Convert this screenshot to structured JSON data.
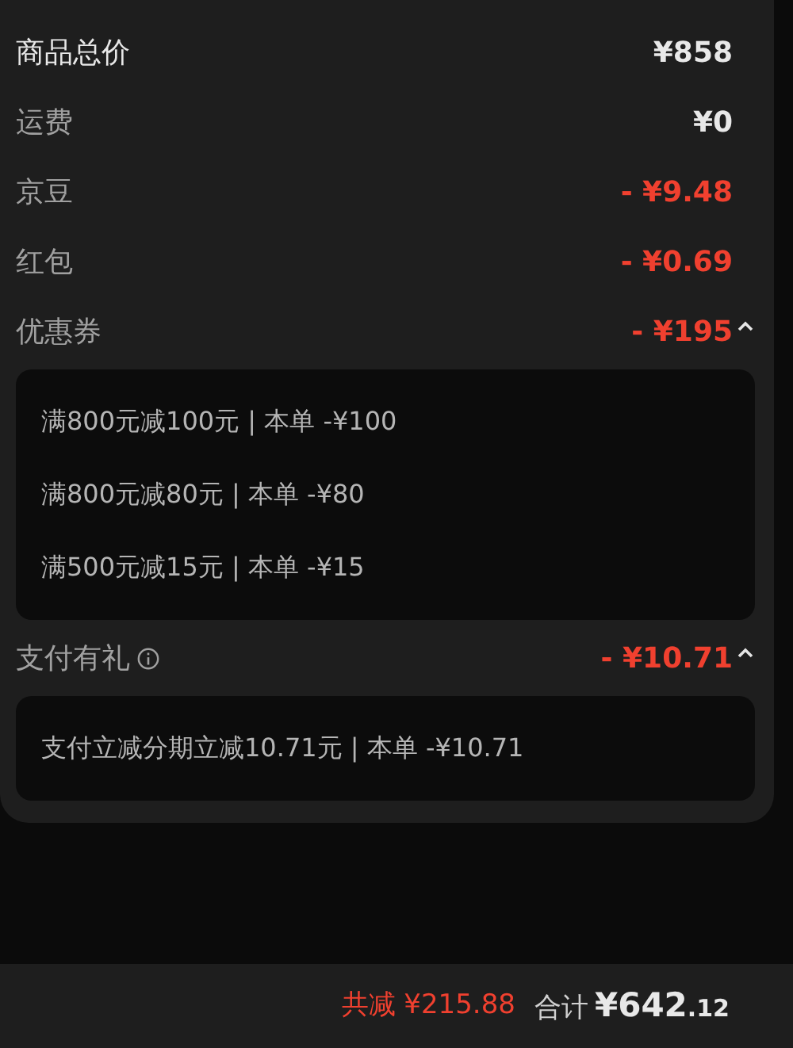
{
  "rows": [
    {
      "kind": "total",
      "label": "商品总价",
      "value": "¥858"
    },
    {
      "kind": "fee",
      "label": "运费",
      "value": "¥0"
    },
    {
      "kind": "discount",
      "label": "京豆",
      "value": "- ¥9.48"
    },
    {
      "kind": "discount",
      "label": "红包",
      "value": "- ¥0.69"
    },
    {
      "kind": "group",
      "label": "优惠券",
      "value": "- ¥195",
      "info": false,
      "expanded": true,
      "items": [
        "满800元减100元 | 本单 -¥100",
        "满800元减80元 | 本单 -¥80",
        "满500元减15元 | 本单 -¥15"
      ]
    },
    {
      "kind": "group",
      "label": "支付有礼",
      "value": "- ¥10.71",
      "info": true,
      "expanded": true,
      "items": [
        "支付立减分期立减10.71元 | 本单 -¥10.71"
      ]
    }
  ],
  "footer": {
    "discount_label": "共减",
    "discount": "¥215.88",
    "total_label": "合计",
    "total_main": "¥642",
    "total_decimal": ".12"
  }
}
